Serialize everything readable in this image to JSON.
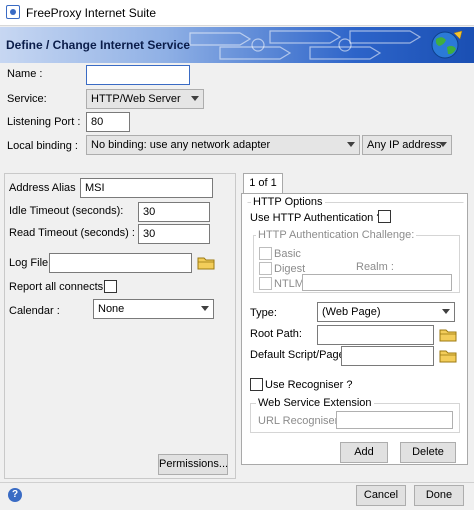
{
  "window": {
    "title": "FreeProxy Internet Suite"
  },
  "banner": {
    "title": "Define / Change Internet Service"
  },
  "form": {
    "name_label": "Name :",
    "name_value": "",
    "service_label": "Service:",
    "service_value": "HTTP/Web Server",
    "port_label": "Listening Port :",
    "port_value": "80",
    "binding_label": "Local binding :",
    "binding_value": "No binding: use any network adapter",
    "ip_value": "Any IP address"
  },
  "left": {
    "alias_label": "Address Alias",
    "alias_value": "MSI",
    "idle_label": "Idle Timeout (seconds):",
    "idle_value": "30",
    "read_label": "Read Timeout (seconds) :",
    "read_value": "30",
    "logfile_label": "Log File :",
    "logfile_value": "",
    "report_label": "Report all connects ?",
    "calendar_label": "Calendar :",
    "calendar_value": "None",
    "permissions_label": "Permissions..."
  },
  "tab": {
    "label": "1 of 1",
    "http_options": "HTTP Options",
    "use_auth_label": "Use HTTP Authentication  ?",
    "challenge_label": "HTTP Authentication Challenge:",
    "basic_label": "Basic",
    "digest_label": "Digest",
    "ntlm_label": "NTLM",
    "realm_label": "Realm :",
    "type_label": "Type:",
    "type_value": "(Web Page)",
    "root_label": "Root Path:",
    "root_value": "",
    "default_label": "Default Script/Page:",
    "default_value": "",
    "use_recogniser_label": "Use Recogniser ?",
    "extension_label": "Web Service Extension",
    "url_label": "URL Recogniser:",
    "add_label": "Add",
    "delete_label": "Delete"
  },
  "footer": {
    "cancel_label": "Cancel",
    "done_label": "Done"
  },
  "colors": {
    "banner_dark": "#1a4fb3",
    "banner_light": "#c7d7f2",
    "window_bg": "#f0f0f0"
  },
  "icons": [
    "app-icon",
    "globe-icon",
    "folder-icon",
    "help-icon"
  ]
}
